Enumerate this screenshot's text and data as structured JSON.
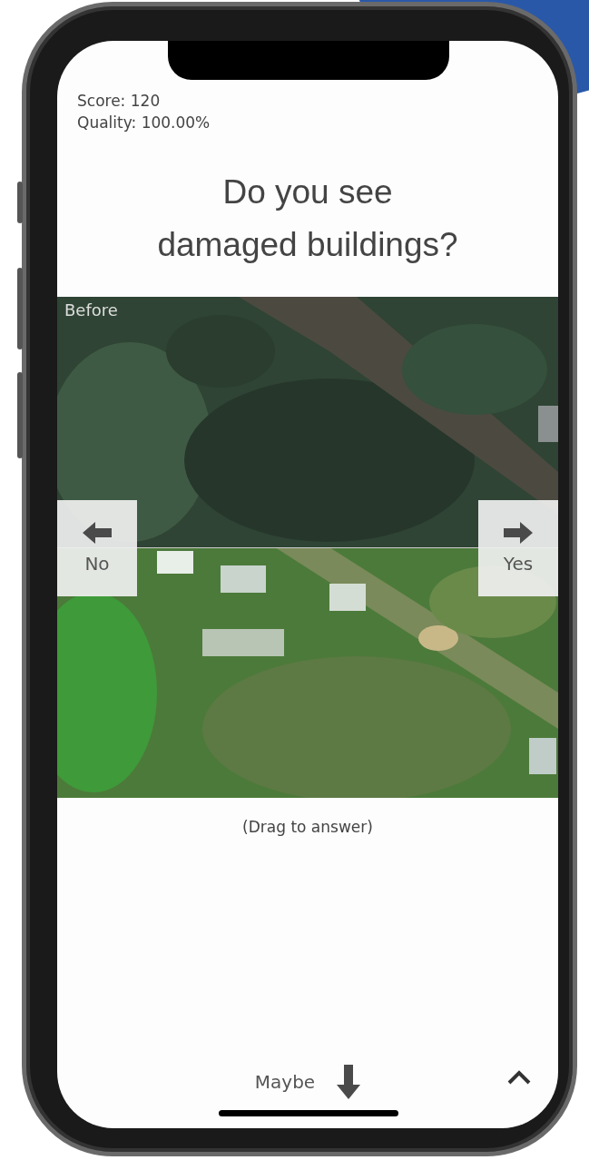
{
  "stats": {
    "score": "Score: 120",
    "quality": "Quality: 100.00%"
  },
  "question_lines": [
    "Do you see",
    "damaged buildings?"
  ],
  "comparison": {
    "before_label": "Before"
  },
  "answers": [
    {
      "kind": "left",
      "label": "No"
    },
    {
      "kind": "right",
      "label": "Yes"
    }
  ],
  "hint": "(Drag to answer)",
  "bottom_bar": {
    "maybe": "Maybe"
  }
}
